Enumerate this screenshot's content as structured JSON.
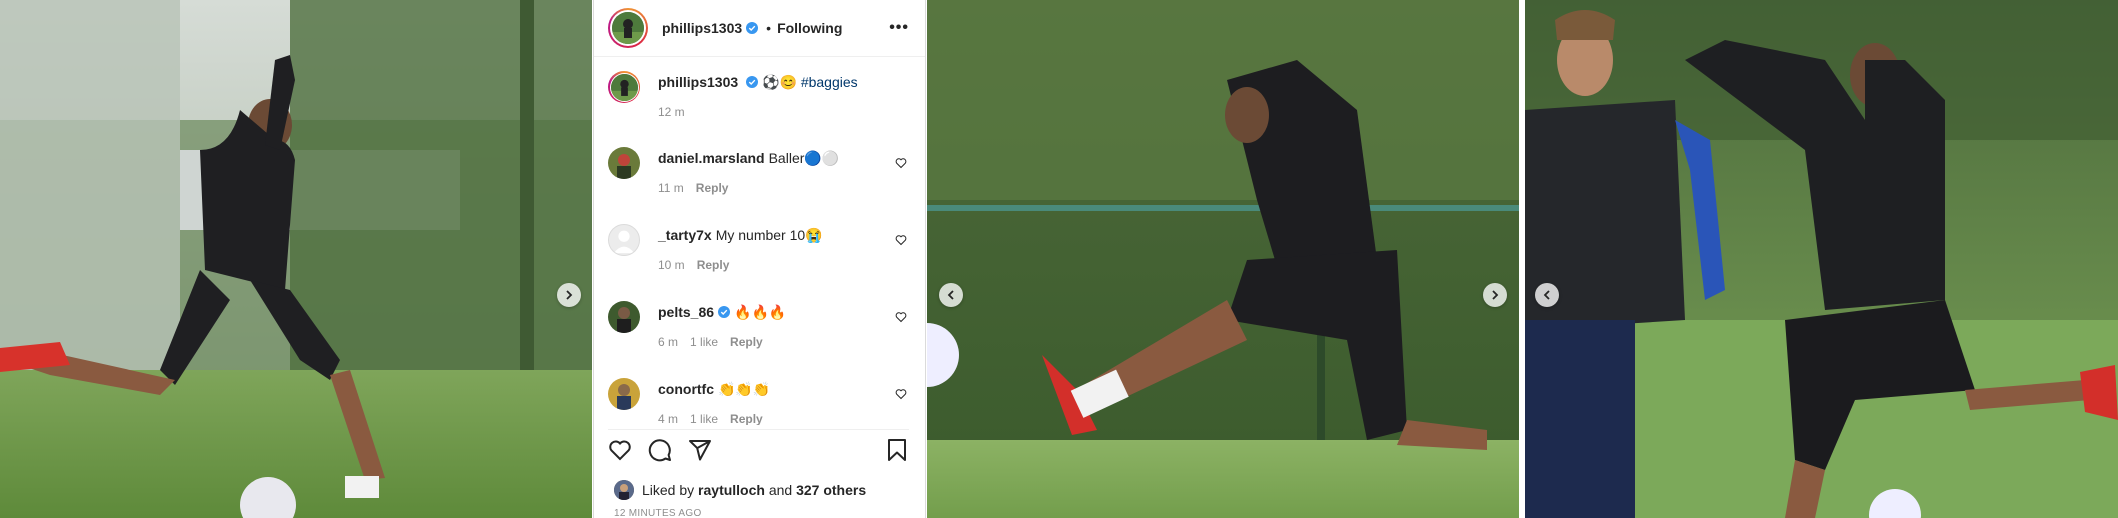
{
  "post": {
    "username": "phillips1303",
    "dot": "•",
    "follow_status": "Following",
    "more_label": "•••"
  },
  "caption": {
    "username": "phillips1303",
    "emoji_text": "⚽😊",
    "hashtag": "#baggies",
    "time": "12 m"
  },
  "comments": [
    {
      "username": "daniel.marsland",
      "text": "Baller🔵⚪",
      "time": "11 m",
      "likes": "",
      "reply": "Reply",
      "verified": false
    },
    {
      "username": "_tarty7x",
      "text": "My number 10😭",
      "time": "10 m",
      "likes": "",
      "reply": "Reply",
      "verified": false
    },
    {
      "username": "pelts_86",
      "text": "🔥🔥🔥",
      "time": "6 m",
      "likes": "1 like",
      "reply": "Reply",
      "verified": true
    },
    {
      "username": "conortfc",
      "text": "👏👏👏",
      "time": "4 m",
      "likes": "1 like",
      "reply": "Reply",
      "verified": false
    }
  ],
  "likes": {
    "prefix": "Liked by",
    "user": "raytulloch",
    "middle": "and",
    "others": "327 others"
  },
  "timestamp_cut": "12 MINUTES AGO",
  "icons": {
    "verified": "verified-badge-icon",
    "heart": "heart-icon",
    "comment": "comment-icon",
    "share": "share-icon",
    "bookmark": "bookmark-icon",
    "prev": "chevron-left-icon",
    "next": "chevron-right-icon"
  },
  "colors": {
    "verified": "#3897f0",
    "hashtag": "#00376b",
    "muted": "#8e8e8e"
  }
}
